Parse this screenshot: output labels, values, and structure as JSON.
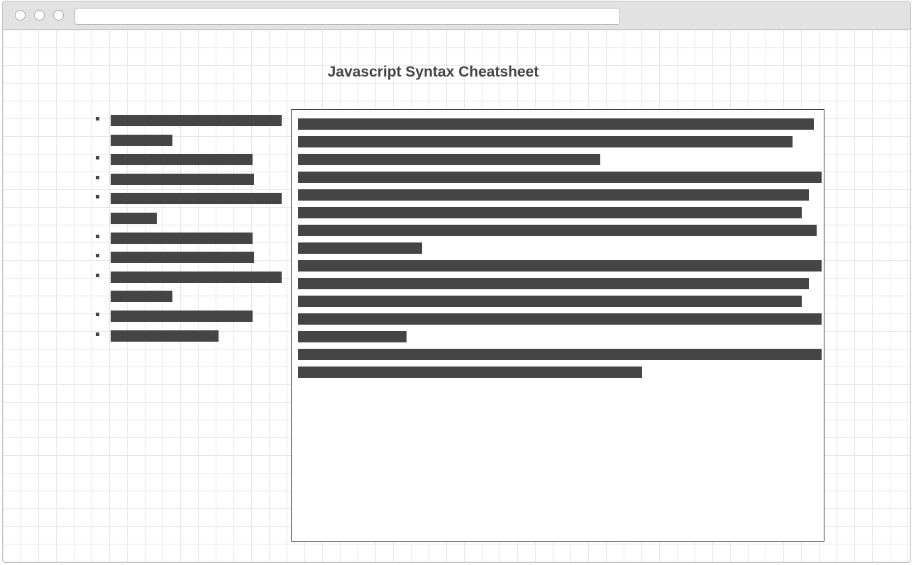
{
  "window": {
    "url": ""
  },
  "page": {
    "title": "Javascript Syntax Cheatsheet"
  },
  "sidebar": {
    "items": [
      {
        "label": "",
        "placeholder_lines": 2,
        "line_fill": [
          1.0,
          0.36
        ]
      },
      {
        "label": "",
        "placeholder_lines": 1,
        "line_fill": [
          0.83
        ]
      },
      {
        "label": "",
        "placeholder_lines": 1,
        "line_fill": [
          0.84
        ]
      },
      {
        "label": "",
        "placeholder_lines": 2,
        "line_fill": [
          1.0,
          0.27
        ]
      },
      {
        "label": "",
        "placeholder_lines": 1,
        "line_fill": [
          0.83
        ]
      },
      {
        "label": "",
        "placeholder_lines": 1,
        "line_fill": [
          0.84
        ]
      },
      {
        "label": "",
        "placeholder_lines": 2,
        "line_fill": [
          1.0,
          0.36
        ]
      },
      {
        "label": "",
        "placeholder_lines": 1,
        "line_fill": [
          0.83
        ]
      },
      {
        "label": "",
        "placeholder_lines": 1,
        "line_fill": [
          0.63
        ]
      }
    ]
  },
  "content": {
    "text_line_fill": [
      0.985,
      0.945,
      0.577,
      1.0,
      0.975,
      0.962,
      0.99,
      0.237,
      1.0,
      0.975,
      0.962,
      1.0,
      0.207,
      1.0,
      0.657
    ]
  }
}
